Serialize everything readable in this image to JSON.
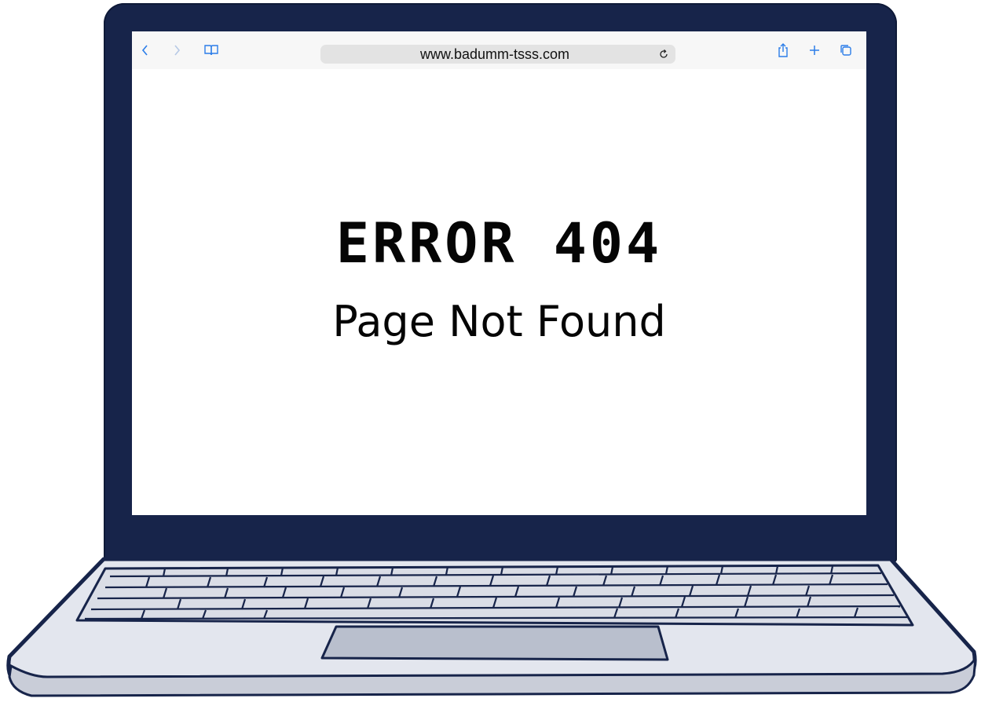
{
  "browser": {
    "url": "www.badumm-tsss.com",
    "icons": {
      "back": "chevron-left-icon",
      "forward": "chevron-right-icon",
      "bookmarks": "open-book-icon",
      "reload": "reload-icon",
      "share": "share-icon",
      "new_tab": "plus-icon",
      "tabs": "tabs-icon"
    },
    "accent_color": "#2b7de9"
  },
  "page": {
    "title": "ERROR 404",
    "subtitle": "Page Not Found"
  },
  "device": {
    "bezel_color": "#17244a",
    "body_color": "#e3e6ee"
  }
}
